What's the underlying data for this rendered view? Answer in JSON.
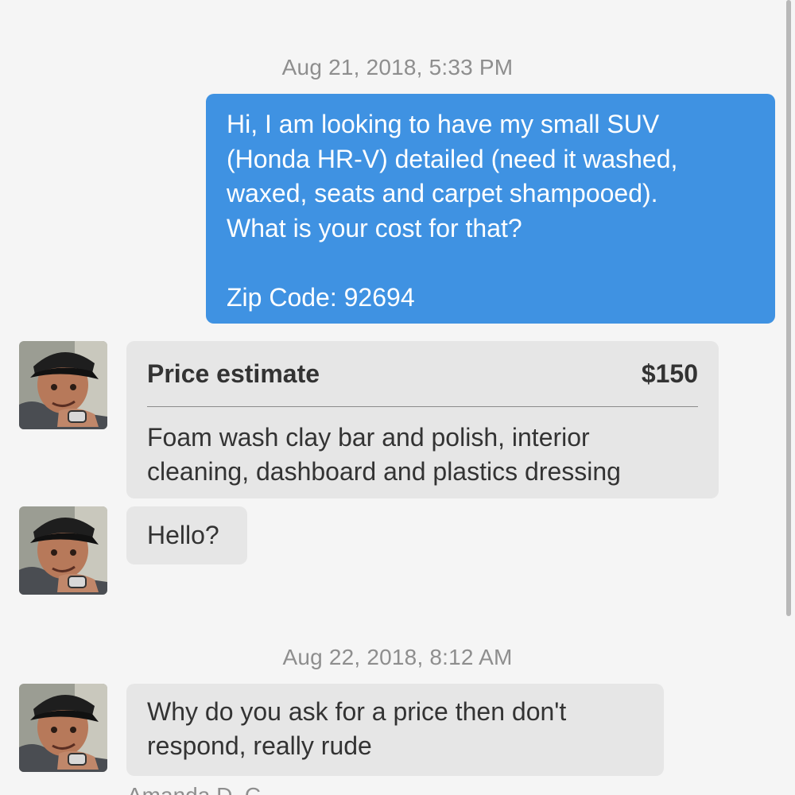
{
  "conversation": {
    "timestamps": [
      "Aug 21, 2018, 5:33 PM",
      "Aug 22, 2018, 8:12 AM"
    ],
    "outgoing": {
      "text": "Hi, I am looking to have my small SUV\n(Honda HR-V) detailed (need it washed,\nwaxed, seats and carpet shampooed).\nWhat is your cost for that?\n\nZip Code: 92694",
      "color": "#3f92e2"
    },
    "estimate": {
      "title": "Price estimate",
      "price": "$150",
      "description": "Foam wash clay bar and polish, interior cleaning, dashboard and plastics dressing"
    },
    "incoming": [
      {
        "text": "Hello?"
      },
      {
        "text": "Why do you ask for a price then don't respond, really rude"
      }
    ],
    "cut_off_text": "Amanda D. C...",
    "avatar_icon": "user-photo"
  }
}
